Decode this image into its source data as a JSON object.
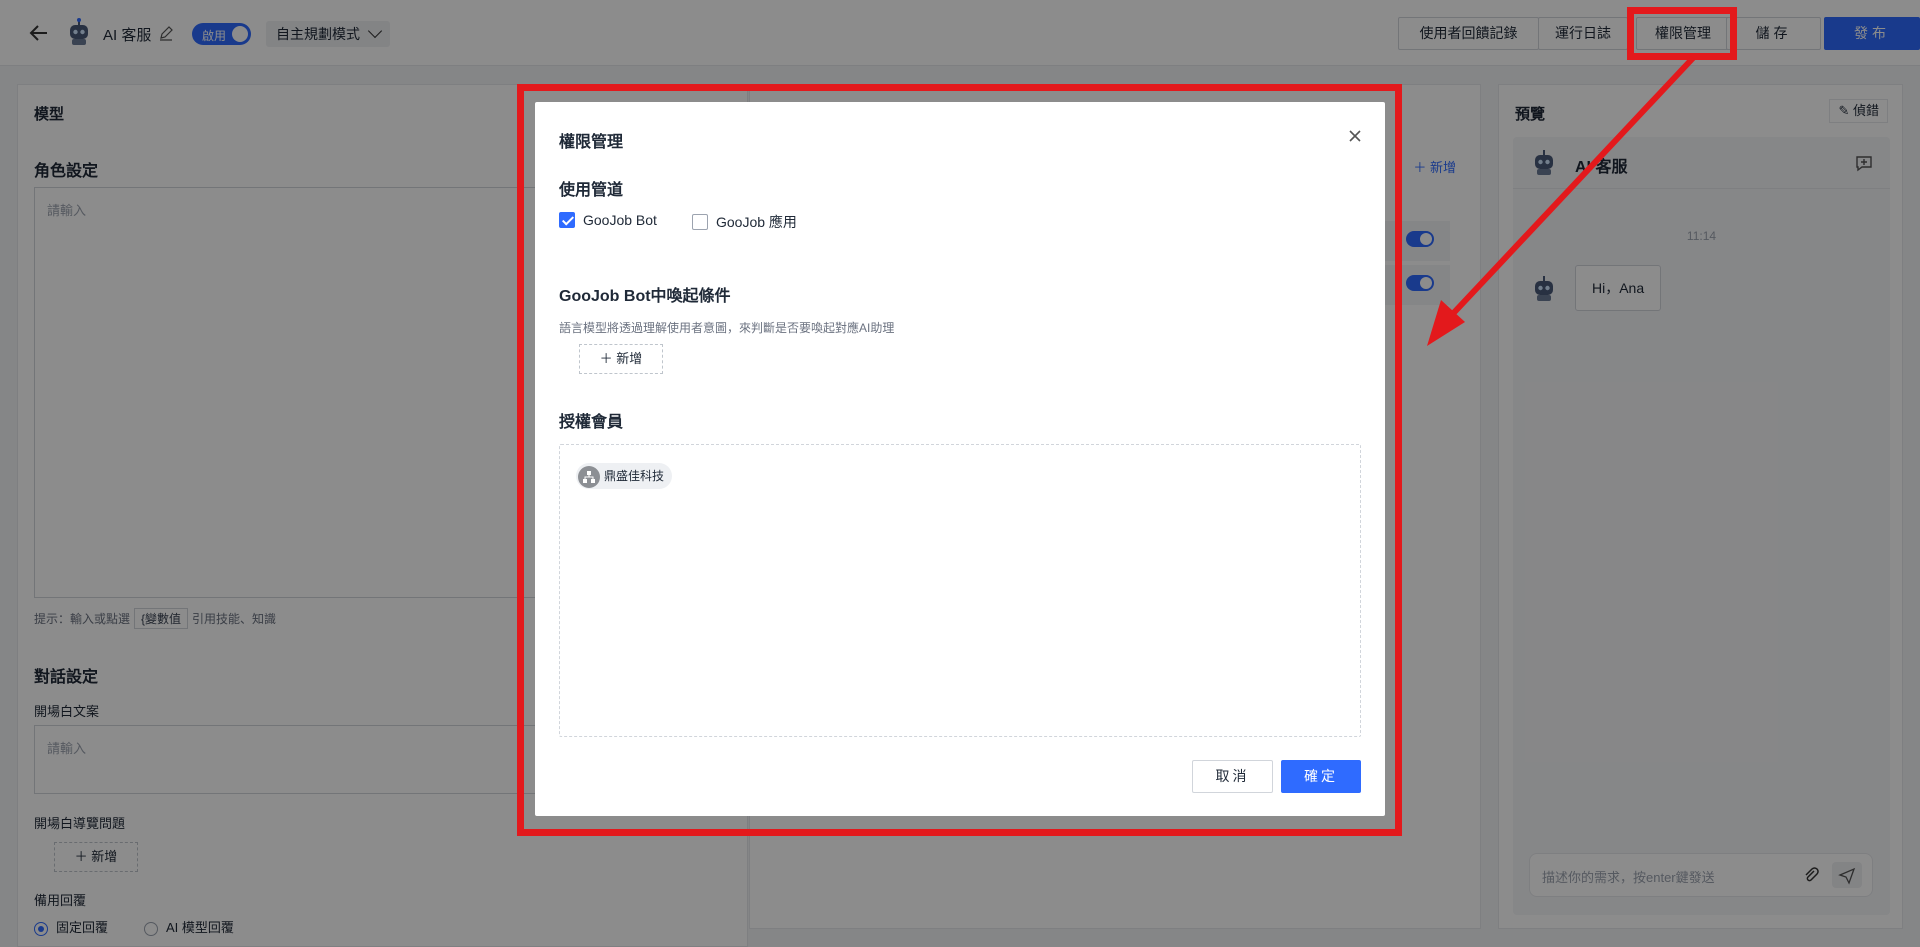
{
  "header": {
    "app_name": "AI 客服",
    "enable_label": "啟用",
    "mode_label": "自主規劃模式",
    "buttons": {
      "feedback": "使用者回饋記錄",
      "run_log": "運行日誌",
      "permissions": "權限管理",
      "save": "儲存",
      "publish": "發布"
    }
  },
  "model_panel": {
    "title": "模型",
    "role_section": "角色設定",
    "role_placeholder": "請輸入",
    "hint_prefix": "提示：輸入或點選",
    "hint_variable": "{變數值",
    "hint_suffix": "引用技能、知識",
    "dialog_section": "對話設定",
    "opening_label": "開場白文案",
    "opening_placeholder": "請輸入",
    "guide_label": "開場白導覽問題",
    "add_label": "新增",
    "fallback_label": "備用回覆",
    "radio_fixed": "固定回覆",
    "radio_ai": "AI 模型回覆"
  },
  "middle_panel": {
    "add_label": "新增"
  },
  "preview": {
    "title": "預覽",
    "debug_label": "偵錯",
    "chat_title": "AI 客服",
    "time": "11:14",
    "greeting": "Hi，Ana",
    "input_placeholder": "描述你的需求，按enter鍵發送"
  },
  "modal": {
    "title": "權限管理",
    "channels_title": "使用管道",
    "channels": [
      {
        "label": "GooJob Bot",
        "checked": true
      },
      {
        "label": "GooJob 應用",
        "checked": false
      }
    ],
    "trigger_title": "GooJob Bot中喚起條件",
    "trigger_desc": "語言模型將透過理解使用者意圖，來判斷是否要喚起對應AI助理",
    "add_label": "新增",
    "members_title": "授權會員",
    "members": [
      "鼎盛佳科技"
    ],
    "cancel_label": "取消",
    "confirm_label": "確定"
  },
  "colors": {
    "primary": "#2f6bff",
    "annotation": "#e3191c"
  }
}
